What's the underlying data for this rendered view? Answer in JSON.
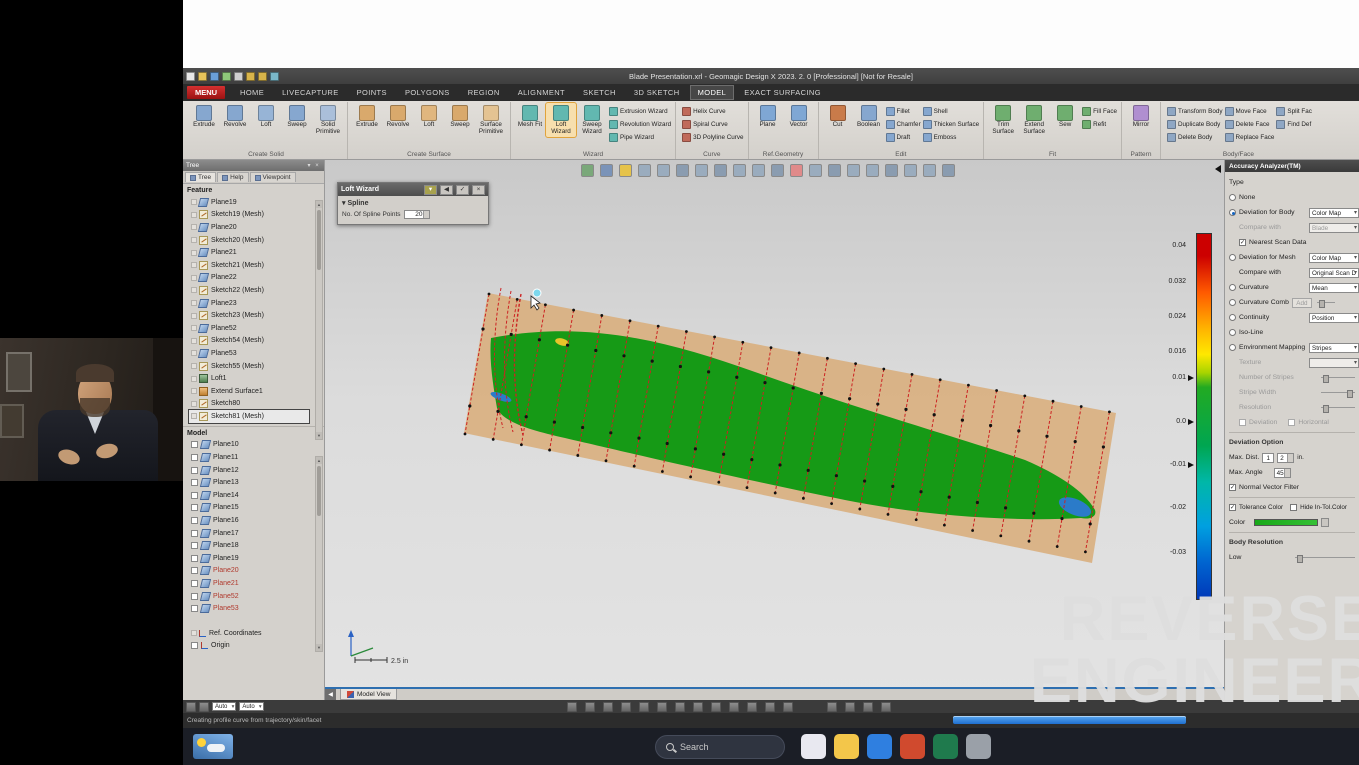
{
  "window": {
    "title": "Blade Presentation.xrl - Geomagic Design X 2023. 2. 0 [Professional] [Not for Resale]",
    "quick_icons": [
      {
        "name": "new-icon",
        "color": "#e8e8e8"
      },
      {
        "name": "open-icon",
        "color": "#e8c35a"
      },
      {
        "name": "save-icon",
        "color": "#6a9fd8"
      },
      {
        "name": "import-icon",
        "color": "#8fc97a"
      },
      {
        "name": "print-icon",
        "color": "#cfcfcf"
      },
      {
        "name": "undo-icon",
        "color": "#d8b44a"
      },
      {
        "name": "redo-icon",
        "color": "#d8b44a"
      },
      {
        "name": "help-icon",
        "color": "#7ab8c9"
      }
    ]
  },
  "menu": {
    "menu_button": "MENU",
    "tabs": [
      {
        "label": "HOME"
      },
      {
        "label": "LIVECAPTURE"
      },
      {
        "label": "POINTS"
      },
      {
        "label": "POLYGONS"
      },
      {
        "label": "REGION"
      },
      {
        "label": "ALIGNMENT"
      },
      {
        "label": "SKETCH"
      },
      {
        "label": "3D SKETCH"
      },
      {
        "label": "MODEL",
        "cls": "active"
      },
      {
        "label": "EXACT SURFACING"
      }
    ]
  },
  "ribbon": {
    "create_solid": {
      "label": "Create Solid",
      "buttons": [
        {
          "label": "Extrude",
          "color": "#86a7cf"
        },
        {
          "label": "Revolve",
          "color": "#86a7cf"
        },
        {
          "label": "Loft",
          "color": "#97b4d6"
        },
        {
          "label": "Sweep",
          "color": "#86a7cf"
        },
        {
          "label": "Solid Primitive",
          "color": "#aabfda"
        }
      ]
    },
    "create_surface": {
      "label": "Create Surface",
      "buttons": [
        {
          "label": "Extrude",
          "color": "#d9a96c"
        },
        {
          "label": "Revolve",
          "color": "#d9a96c"
        },
        {
          "label": "Loft",
          "color": "#e0b67e"
        },
        {
          "label": "Sweep",
          "color": "#d9a96c"
        },
        {
          "label": "Surface Primitive",
          "color": "#e4c392"
        }
      ]
    },
    "wizard": {
      "label": "Wizard",
      "buttons": [
        {
          "label": "Mesh Fit",
          "color": "#62b8b0"
        },
        {
          "label": "Loft Wizard",
          "color": "#62b8b0",
          "cls": "active"
        },
        {
          "label": "Sweep Wizard",
          "color": "#62b8b0"
        }
      ],
      "items": [
        {
          "label": "Extrusion Wizard",
          "color": "#62b8b0"
        },
        {
          "label": "Revolution Wizard",
          "color": "#62b8b0"
        },
        {
          "label": "Pipe Wizard",
          "color": "#62b8b0"
        }
      ]
    },
    "curve": {
      "label": "Curve",
      "items": [
        {
          "label": "Helix Curve",
          "color": "#c06a5a"
        },
        {
          "label": "Spiral Curve",
          "color": "#c06a5a"
        },
        {
          "label": "3D Polyline Curve",
          "color": "#c06a5a"
        }
      ]
    },
    "ref_geometry": {
      "label": "Ref.Geometry",
      "buttons": [
        {
          "label": "Plane",
          "color": "#7fa7d4"
        },
        {
          "label": "Vector",
          "color": "#7fa7d4"
        }
      ]
    },
    "edit": {
      "label": "Edit",
      "buttons": [
        {
          "label": "Cut",
          "color": "#c97b4a"
        },
        {
          "label": "Boolean",
          "color": "#86a7cf"
        }
      ],
      "col1": [
        {
          "label": "Fillet",
          "color": "#86a7cf"
        },
        {
          "label": "Chamfer",
          "color": "#86a7cf"
        },
        {
          "label": "Draft",
          "color": "#86a7cf"
        }
      ],
      "col2": [
        {
          "label": "Shell",
          "color": "#86a7cf"
        },
        {
          "label": "Thicken Surface",
          "color": "#86a7cf"
        },
        {
          "label": "Emboss",
          "color": "#86a7cf"
        }
      ]
    },
    "fit": {
      "label": "Fit",
      "buttons": [
        {
          "label": "Trim Surface",
          "color": "#6fae6f"
        },
        {
          "label": "Extend Surface",
          "color": "#6fae6f"
        },
        {
          "label": "Sew",
          "color": "#6fae6f"
        }
      ],
      "items": [
        {
          "label": "Fill Face",
          "color": "#6fae6f"
        },
        {
          "label": "Refit",
          "color": "#6fae6f"
        }
      ]
    },
    "pattern": {
      "label": "Pattern",
      "buttons": [
        {
          "label": "Mirror",
          "color": "#b08fd0"
        }
      ]
    },
    "body_face": {
      "label": "Body/Face",
      "col1": [
        {
          "label": "Transform Body",
          "color": "#8fa7c4"
        },
        {
          "label": "Duplicate Body",
          "color": "#8fa7c4"
        },
        {
          "label": "Delete Body",
          "color": "#8fa7c4"
        }
      ],
      "col2": [
        {
          "label": "Move Face",
          "color": "#8fa7c4"
        },
        {
          "label": "Delete Face",
          "color": "#8fa7c4"
        },
        {
          "label": "Replace Face",
          "color": "#8fa7c4"
        }
      ],
      "col3": [
        {
          "label": "Split Fac",
          "color": "#8fa7c4"
        },
        {
          "label": "Find Def",
          "color": "#8fa7c4"
        }
      ]
    }
  },
  "tree": {
    "panel_title": "Tree",
    "tabs": [
      {
        "label": "Tree",
        "cls": "on"
      },
      {
        "label": "Help"
      },
      {
        "label": "Viewpoint"
      }
    ],
    "feature_header": "Feature",
    "feature_items": [
      {
        "label": "Plane19",
        "icon": "plane"
      },
      {
        "label": "Sketch19 (Mesh)",
        "icon": "sketch"
      },
      {
        "label": "Plane20",
        "icon": "plane"
      },
      {
        "label": "Sketch20 (Mesh)",
        "icon": "sketch"
      },
      {
        "label": "Plane21",
        "icon": "plane"
      },
      {
        "label": "Sketch21 (Mesh)",
        "icon": "sketch"
      },
      {
        "label": "Plane22",
        "icon": "plane"
      },
      {
        "label": "Sketch22 (Mesh)",
        "icon": "sketch"
      },
      {
        "label": "Plane23",
        "icon": "plane"
      },
      {
        "label": "Sketch23 (Mesh)",
        "icon": "sketch"
      },
      {
        "label": "Plane52",
        "icon": "plane"
      },
      {
        "label": "Sketch54 (Mesh)",
        "icon": "sketch"
      },
      {
        "label": "Plane53",
        "icon": "plane"
      },
      {
        "label": "Sketch55 (Mesh)",
        "icon": "sketch"
      },
      {
        "label": "Loft1",
        "icon": "loft"
      },
      {
        "label": "Extend Surface1",
        "icon": "surface"
      },
      {
        "label": "Sketch80",
        "icon": "sketch"
      },
      {
        "label": "Sketch81 (Mesh)",
        "icon": "sketch",
        "cls": "selected"
      }
    ],
    "model_header": "Model",
    "model_items": [
      {
        "label": "Plane10"
      },
      {
        "label": "Plane11"
      },
      {
        "label": "Plane12"
      },
      {
        "label": "Plane13"
      },
      {
        "label": "Plane14"
      },
      {
        "label": "Plane15"
      },
      {
        "label": "Plane16"
      },
      {
        "label": "Plane17"
      },
      {
        "label": "Plane18"
      },
      {
        "label": "Plane19"
      },
      {
        "label": "Plane20",
        "cls": "red"
      },
      {
        "label": "Plane21",
        "cls": "red"
      },
      {
        "label": "Plane52",
        "cls": "red"
      },
      {
        "label": "Plane53",
        "cls": "red"
      }
    ],
    "ref_coordinates": "Ref. Coordinates",
    "origin": "Origin"
  },
  "loft_wizard": {
    "title": "Loft Wizard",
    "section": "Spline",
    "spline_points_label": "No. Of Spline Points",
    "spline_points_value": "20"
  },
  "viewport": {
    "bottom_tab": "Model View",
    "axis_scale": "2.5 in",
    "sections": {
      "count": 23
    },
    "toolbar_icons": [
      {
        "name": "camera-icon",
        "color": "#7aa87a"
      },
      {
        "name": "capture-icon",
        "color": "#7a93b8"
      },
      {
        "name": "palette-icon",
        "color": "#e6c34a"
      },
      {
        "name": "render-mode-icon",
        "color": "#9aacbe"
      },
      {
        "name": "wireframe-icon",
        "color": "#9aacbe"
      },
      {
        "name": "shade-icon",
        "color": "#8a9cb0"
      },
      {
        "name": "mesh-display-icon",
        "color": "#9aacbe"
      },
      {
        "name": "region-display-icon",
        "color": "#8a9cb0"
      },
      {
        "name": "body-display-icon",
        "color": "#9aacbe"
      },
      {
        "name": "plane-display-icon",
        "color": "#9aacbe"
      },
      {
        "name": "point-display-icon",
        "color": "#8a9cb0"
      },
      {
        "name": "section-highlight-icon",
        "color": "#e08a8a"
      },
      {
        "name": "curve-display-icon",
        "color": "#9aacbe"
      },
      {
        "name": "coordinate-display-icon",
        "color": "#8a9cb0"
      },
      {
        "name": "measure-icon",
        "color": "#9aacbe"
      },
      {
        "name": "note-icon",
        "color": "#9aacbe"
      },
      {
        "name": "light-icon",
        "color": "#8a9cb0"
      },
      {
        "name": "grid-icon",
        "color": "#9aacbe"
      },
      {
        "name": "target-icon",
        "color": "#9aacbe"
      },
      {
        "name": "display-settings-icon",
        "color": "#8a9cb0"
      }
    ]
  },
  "color_scale": {
    "labels": [
      "0.04",
      "0.032",
      "0.024",
      "0.016",
      "0.01",
      "0.0",
      "-0.01",
      "-0.02",
      "-0.03"
    ],
    "top_color": "#cc0000",
    "mid_color": "#00a651",
    "bottom_color": "#0038b8"
  },
  "accuracy": {
    "title": "Accuracy Analyzer(TM)",
    "type_label": "Type",
    "none": "None",
    "dev_body": "Deviation for Body",
    "dev_body_value": "Color Map",
    "compare_with": "Compare with",
    "compare_with_value": "Blade",
    "nearest": "Nearest Scan Data",
    "dev_mesh": "Deviation for Mesh",
    "dev_mesh_value": "Color Map",
    "compare_with2": "Compare with",
    "compare_with2_value": "Original Scan D",
    "curvature": "Curvature",
    "curvature_value": "Mean",
    "curvature_comb": "Curvature Comb",
    "curvature_comb_btn": "Add",
    "continuity": "Continuity",
    "continuity_value": "Position",
    "iso_line": "Iso-Line",
    "env_mapping": "Environment Mapping",
    "env_mapping_value": "Stripes",
    "texture": "Texture",
    "num_stripes": "Number of Stripes",
    "stripe_width": "Stripe Width",
    "resolution": "Resolution",
    "deviation": "Deviation",
    "horizontal": "Horizontal",
    "deviation_option": "Deviation Option",
    "max_dist": "Max. Dist.",
    "max_dist_v1": "1",
    "max_dist_v2": "2",
    "max_dist_unit": "in.",
    "max_angle": "Max. Angle",
    "max_angle_value": "45",
    "normal_vector": "Normal Vector Filter",
    "tolerance_color": "Tolerance Color",
    "hide_intol": "Hide In-Tol.Color",
    "color_label": "Color",
    "tolerance_green": "#21a121",
    "body_resolution": "Body Resolution",
    "body_res_value": "Low"
  },
  "status": {
    "combos": [
      "Auto",
      "Auto"
    ],
    "left_icons": [
      {
        "name": "filter-icon"
      },
      {
        "name": "snap-icon"
      }
    ],
    "center_icons": [
      {
        "name": "zoom-in-icon"
      },
      {
        "name": "zoom-out-icon"
      },
      {
        "name": "zoom-fit-icon"
      },
      {
        "name": "zoom-window-icon"
      },
      {
        "name": "pan-icon"
      },
      {
        "name": "rotate-icon"
      },
      {
        "name": "front-view-icon"
      },
      {
        "name": "top-view-icon"
      },
      {
        "name": "iso-view-icon"
      },
      {
        "name": "perspective-icon"
      },
      {
        "name": "shade-mode-icon"
      },
      {
        "name": "wireframe-mode-icon"
      },
      {
        "name": "display-settings-icon"
      }
    ],
    "right_icons": [
      {
        "name": "panel-toggle-icon"
      },
      {
        "name": "measure-icon"
      },
      {
        "name": "section-icon"
      },
      {
        "name": "screenshot-icon"
      }
    ],
    "message": "Creating profile curve from trajectory/skin/facet"
  },
  "taskbar": {
    "search": "Search",
    "icons": [
      {
        "name": "copilot-icon",
        "color": "#e8e8f0"
      },
      {
        "name": "folder-icon",
        "color": "#f3c64a"
      },
      {
        "name": "edge-icon",
        "color": "#2f7fe0"
      },
      {
        "name": "app-orange-icon",
        "color": "#d04a2e"
      },
      {
        "name": "designx-icon",
        "color": "#1f7a4d"
      },
      {
        "name": "app-gray-icon",
        "color": "#9aa0a8"
      }
    ]
  },
  "watermark": {
    "line1": "REVERSE",
    "line2": "ENGINEER"
  }
}
